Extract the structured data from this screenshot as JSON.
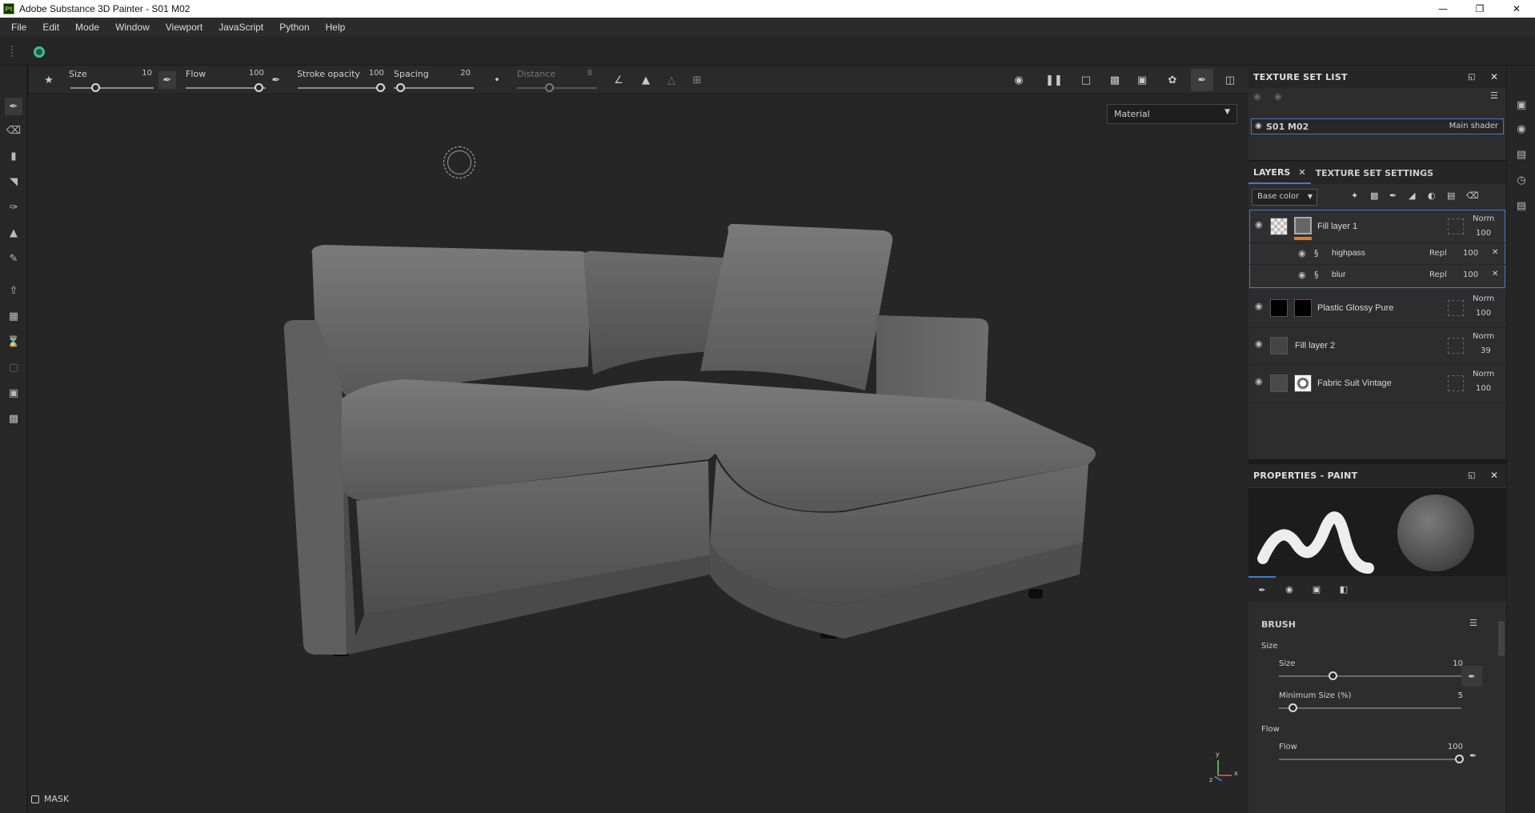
{
  "window": {
    "title": "Adobe Substance 3D Painter - S01 M02",
    "app_badge": "Pt"
  },
  "menu": [
    "File",
    "Edit",
    "Mode",
    "Window",
    "Viewport",
    "JavaScript",
    "Python",
    "Help"
  ],
  "toolbar": {
    "size_label": "Size",
    "size_value": "10",
    "flow_label": "Flow",
    "flow_value": "100",
    "stroke_opacity_label": "Stroke opacity",
    "stroke_opacity_value": "100",
    "spacing_label": "Spacing",
    "spacing_value": "20",
    "distance_label": "Distance",
    "distance_value": "8"
  },
  "viewport": {
    "material_dropdown": "Material",
    "mask_label": "MASK",
    "axis_y": "y",
    "axis_x": "x",
    "axis_z": "z"
  },
  "texture_set_list": {
    "title": "TEXTURE SET LIST",
    "item_name": "S01 M02",
    "item_shader": "Main shader"
  },
  "layers_panel": {
    "tab_layers": "LAYERS",
    "tab_texture_set_settings": "TEXTURE SET SETTINGS",
    "channel_dropdown": "Base color",
    "layers": [
      {
        "name": "Fill layer 1",
        "blend": "Norm",
        "opacity": "100"
      },
      {
        "name": "highpass",
        "blend": "Repl",
        "opacity": "100"
      },
      {
        "name": "blur",
        "blend": "Repl",
        "opacity": "100"
      },
      {
        "name": "Plastic Glossy Pure",
        "blend": "Norm",
        "opacity": "100"
      },
      {
        "name": "Fill layer 2",
        "blend": "Norm",
        "opacity": "39"
      },
      {
        "name": "Fabric Suit Vintage",
        "blend": "Norm",
        "opacity": "100"
      }
    ]
  },
  "properties": {
    "title": "PROPERTIES - PAINT",
    "section_brush": "BRUSH",
    "group_size": "Size",
    "size_label": "Size",
    "size_value": "10",
    "min_size_label": "Minimum Size (%)",
    "min_size_value": "5",
    "group_flow": "Flow",
    "flow_label": "Flow",
    "flow_value": "100"
  },
  "colors": {
    "accent": "#3d7bd6",
    "orange": "#e07a2f",
    "background": "#262626"
  }
}
